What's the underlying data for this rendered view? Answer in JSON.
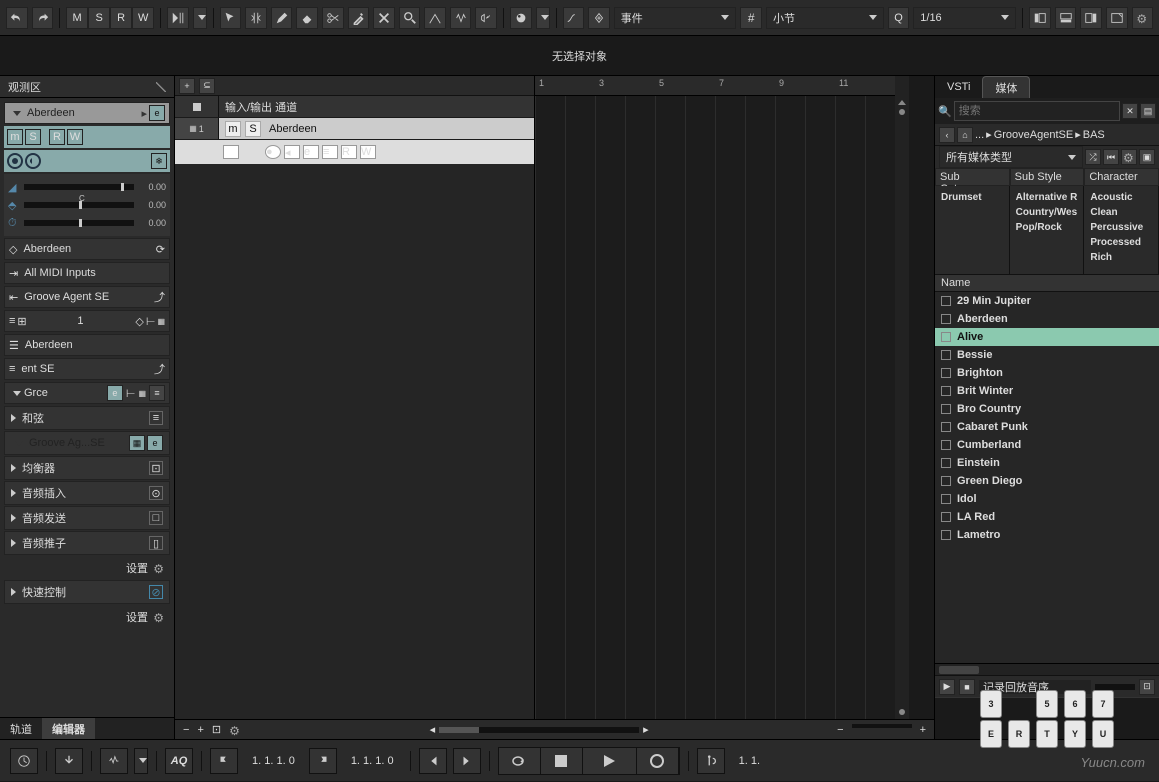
{
  "toolbar": {
    "letters": [
      "M",
      "S",
      "R",
      "W"
    ],
    "event_field": "事件",
    "bar_field": "小节",
    "quantize": "1/16"
  },
  "infobar": {
    "no_selection": "无选择对象"
  },
  "left": {
    "tab": "观测区",
    "track_name": "Aberdeen",
    "mute": "m",
    "solo": "S",
    "read": "R",
    "write": "W",
    "vol": "0.00",
    "pan_c": "C",
    "pan_val": "0.00",
    "delay": "0.00",
    "routing_track": "Aberdeen",
    "midi_in": "All MIDI Inputs",
    "instrument": "Groove Agent SE",
    "channel": "1",
    "track2": "Aberdeen",
    "ent": "ent SE",
    "grce": "Grce",
    "sections": {
      "chord": "和弦",
      "groove_se": "Groove Ag...SE",
      "eq": "均衡器",
      "inserts": "音频插入",
      "sends": "音频发送",
      "fader": "音频推子",
      "quick": "快速控制"
    },
    "settings": "设置",
    "btab_track": "轨道",
    "btab_editor": "编辑器"
  },
  "tracks": {
    "io_row": "输入/输出 通道",
    "track1": "Aberdeen",
    "m": "m",
    "s": "S"
  },
  "ruler": [
    "1",
    "3",
    "5",
    "7",
    "9",
    "11"
  ],
  "right": {
    "tab_vsti": "VSTi",
    "tab_media": "媒体",
    "search_ph": "搜索",
    "bc_dots": "...",
    "bc_groove": "GrooveAgentSE",
    "bc_bas": "BAS",
    "media_type": "所有媒体类型",
    "col1": "Sub Category",
    "col2": "Sub Style",
    "col3": "Character",
    "cat1": [
      "Drumset"
    ],
    "cat2": [
      "Alternative R",
      "Country/Wes",
      "Pop/Rock"
    ],
    "cat3": [
      "Acoustic",
      "Clean",
      "Percussive",
      "Processed",
      "Rich"
    ],
    "name_h": "Name",
    "results": [
      "29 Min Jupiter",
      "Aberdeen",
      "Alive",
      "Bessie",
      "Brighton",
      "Brit Winter",
      "Bro Country",
      "Cabaret Punk",
      "Cumberland",
      "Einstein",
      "Green Diego",
      "Idol",
      "LA Red",
      "Lametro"
    ],
    "selected": "Alive",
    "preview": "记录回放音序",
    "keys": [
      "3",
      "5",
      "6",
      "7",
      "E",
      "R",
      "T",
      "Y",
      "U"
    ]
  },
  "transport": {
    "aq": "AQ",
    "pos1": "1. 1. 1.   0",
    "pos2": "1. 1. 1.   0",
    "pos3": "1. 1."
  },
  "watermark": "Yuucn.com"
}
